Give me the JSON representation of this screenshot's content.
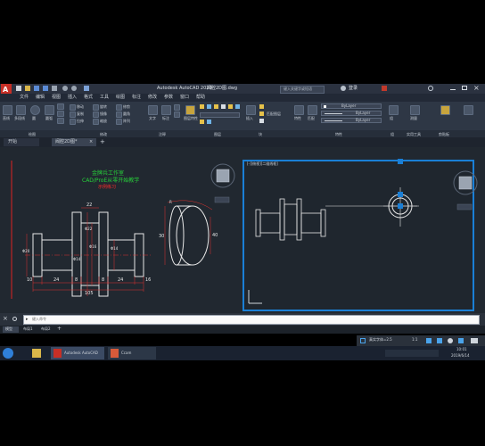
{
  "app": {
    "title": "Autodesk AutoCAD 2020",
    "file_name": "阀腔2D图.dwg",
    "search_placeholder": "键入关键字或短语",
    "user": "登录"
  },
  "menu": [
    "文件",
    "编辑",
    "视图",
    "插入",
    "格式",
    "工具",
    "绘图",
    "标注",
    "修改",
    "参数",
    "窗口",
    "帮助"
  ],
  "ribbon": {
    "draw_tools": [
      "直线",
      "多段线",
      "圆",
      "圆弧"
    ],
    "modify_tools": [
      "移动",
      "旋转",
      "修剪",
      "复制",
      "镜像",
      "圆角",
      "拉伸",
      "缩放",
      "阵列"
    ],
    "annotation_tools": [
      "文字",
      "标注"
    ],
    "layer_tools": [
      "图层特性",
      "匹配图层"
    ],
    "block_tools": [
      "插入",
      "块"
    ],
    "property_tools": [
      "特性",
      "匹配"
    ],
    "bylayer": [
      "ByLayer",
      "ByLayer",
      "ByLayer"
    ],
    "utilities": [
      "测量",
      "组",
      "实用工具",
      "剪贴板"
    ],
    "panels": [
      "绘图",
      "修改",
      "注释",
      "图层",
      "块",
      "特性",
      "组",
      "实用工具",
      "剪贴板"
    ]
  },
  "file_tabs": [
    "开始",
    "阀腔2D图*"
  ],
  "drawing": {
    "heading": [
      "金牌兵工作室",
      "CAD/ProE从零开始教学",
      "示例练习"
    ],
    "dims": {
      "total": "105",
      "segments": [
        "10",
        "24",
        "8",
        "22",
        "8",
        "24",
        "16"
      ],
      "d1": "Φ22",
      "d2": "Φ16",
      "d3": "Φ14",
      "d4": "Φ20",
      "d5": "Φ14",
      "end_h": "30",
      "end_r": "R",
      "end_w": "40"
    },
    "viewport_label": "[-][俯视][二维线框]"
  },
  "command": {
    "placeholder": "键入命令"
  },
  "layout_tabs": [
    "模型",
    "布局1",
    "布局2"
  ],
  "status": {
    "scale": "1:1",
    "annotation": "真实字体=2.5"
  },
  "taskbar": {
    "items": [
      "Autodesk AutoCAD",
      "Ccam"
    ],
    "time": "10:01",
    "date": "2019/6/14"
  },
  "colors": {
    "accent": "#1a7fd6",
    "background": "#212830",
    "dim_red": "#e0332e",
    "line_white": "#e8e8e8",
    "text_green": "#27d23a",
    "text_red": "#ff2a2a"
  }
}
